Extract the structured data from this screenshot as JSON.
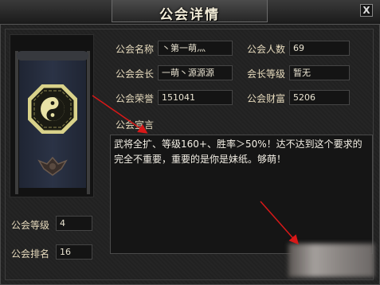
{
  "window": {
    "title": "公会详情",
    "close_label": "X"
  },
  "guild": {
    "name_label": "公会名称",
    "name_value": "丶第一萌灬",
    "members_label": "公会人数",
    "members_value": "69",
    "leader_label": "公会会长",
    "leader_value": "一萌丶源源源",
    "leader_level_label": "会长等级",
    "leader_level_value": "暂无",
    "honor_label": "公会荣誉",
    "honor_value": "151041",
    "wealth_label": "公会财富",
    "wealth_value": "5206",
    "declaration_label": "公会宣言",
    "declaration_text": "武将全扩、等级160+、胜率＞50%！达不达到这个要求的完全不重要，重要的是你是妹纸。够萌！",
    "level_label": "公会等级",
    "level_value": "4",
    "rank_label": "公会排名",
    "rank_value": "16"
  },
  "colors": {
    "arrow": "#d81818",
    "bagua": "#d9d28a",
    "banner": "#2b3346"
  },
  "icons": [
    "bagua-emblem-icon",
    "crest-icon",
    "close-icon"
  ]
}
